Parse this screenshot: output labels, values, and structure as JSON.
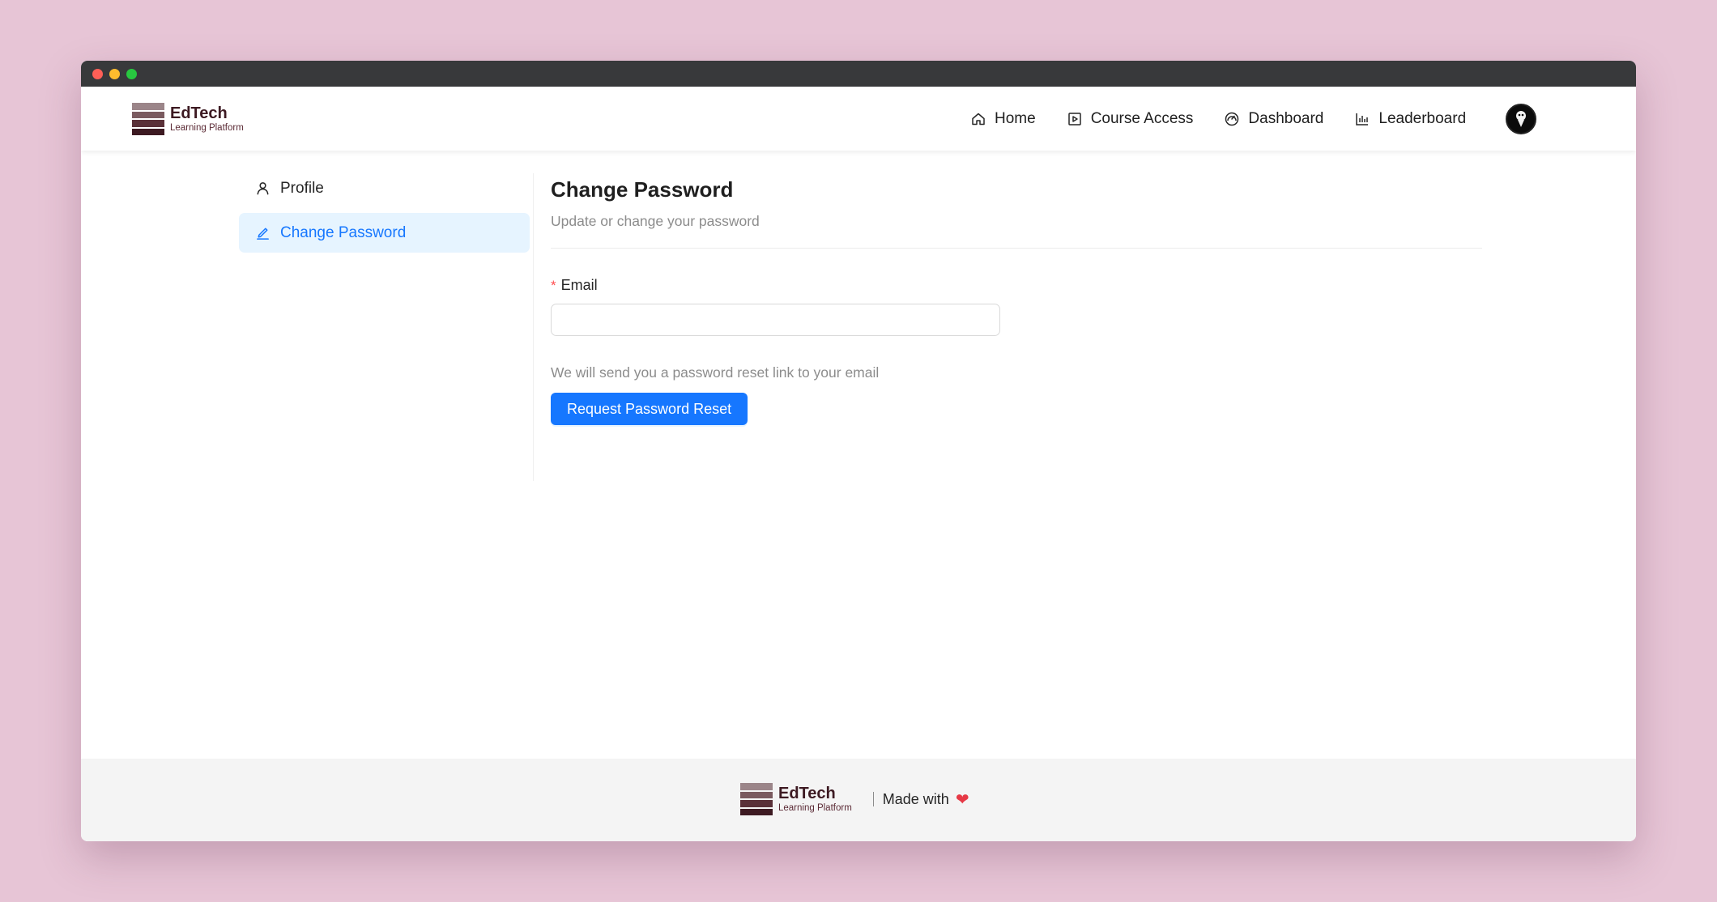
{
  "brand": {
    "name": "EdTech",
    "tagline": "Learning Platform",
    "colors": [
      "#9b8589",
      "#7a5a5f",
      "#5a3038",
      "#3d1a22"
    ]
  },
  "nav": {
    "items": [
      {
        "label": "Home",
        "icon": "home-icon"
      },
      {
        "label": "Course Access",
        "icon": "play-square-icon"
      },
      {
        "label": "Dashboard",
        "icon": "gauge-icon"
      },
      {
        "label": "Leaderboard",
        "icon": "bar-chart-icon"
      }
    ],
    "avatar_icon": "user-avatar-icon"
  },
  "sidebar": {
    "items": [
      {
        "label": "Profile",
        "icon": "user-icon",
        "active": false
      },
      {
        "label": "Change Password",
        "icon": "edit-icon",
        "active": true
      }
    ]
  },
  "main": {
    "title": "Change Password",
    "subtitle": "Update or change your password",
    "email_label": "Email",
    "required_marker": "*",
    "email_value": "",
    "hint": "We will send you a password reset link to your email",
    "submit_label": "Request Password Reset"
  },
  "footer": {
    "brand_name": "EdTech",
    "brand_tagline": "Learning Platform",
    "made_with": "Made with",
    "heart": "❤"
  },
  "colors": {
    "accent": "#1677ff",
    "active_bg": "#e6f4ff",
    "background": "#e7c5d6",
    "required": "#ff4d4f"
  }
}
